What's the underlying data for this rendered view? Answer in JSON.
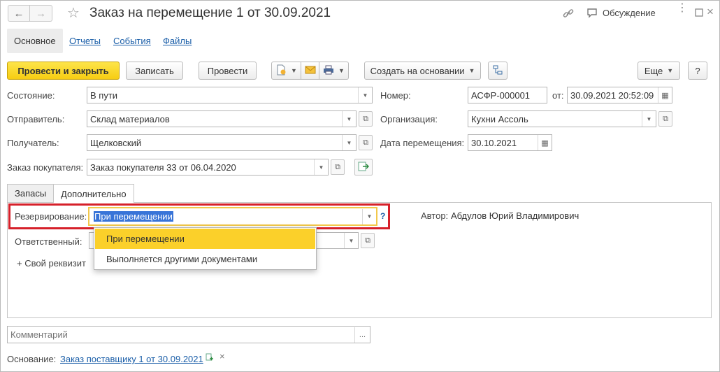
{
  "window": {
    "title": "Заказ на перемещение 1 от 30.09.2021",
    "discussion_label": "Обсуждение"
  },
  "top_tabs": [
    {
      "label": "Основное"
    },
    {
      "label": "Отчеты"
    },
    {
      "label": "События"
    },
    {
      "label": "Файлы"
    }
  ],
  "toolbar": {
    "post_close_label": "Провести и закрыть",
    "save_label": "Записать",
    "post_label": "Провести",
    "create_based_label": "Создать на основании",
    "more_label": "Еще",
    "help_label": "?"
  },
  "form": {
    "state_label": "Состояние:",
    "state_value": "В пути",
    "number_label": "Номер:",
    "number_value": "АСФР-000001",
    "from_label": "от:",
    "date_value": "30.09.2021 20:52:09",
    "sender_label": "Отправитель:",
    "sender_value": "Склад материалов",
    "org_label": "Организация:",
    "org_value": "Кухни Ассоль",
    "receiver_label": "Получатель:",
    "receiver_value": "Щелковский",
    "move_date_label": "Дата перемещения:",
    "move_date_value": "30.10.2021",
    "customer_order_label": "Заказ покупателя:",
    "customer_order_value": "Заказ покупателя 33 от 06.04.2020"
  },
  "inner_tabs": [
    {
      "label": "Запасы"
    },
    {
      "label": "Дополнительно"
    }
  ],
  "extra": {
    "reservation_label": "Резервирование:",
    "reservation_value": "При перемещении",
    "help_mark": "?",
    "author_label": "Автор:",
    "author_value": "Абдулов Юрий Владимирович",
    "responsible_label": "Ответственный:",
    "own_attr_label": "+ Свой реквизит"
  },
  "dropdown_options": [
    {
      "label": "При перемещении",
      "selected": true
    },
    {
      "label": "Выполняется другими документами",
      "selected": false
    }
  ],
  "comment": {
    "placeholder": "Комментарий",
    "button": "..."
  },
  "basis": {
    "label": "Основание:",
    "link": "Заказ поставщику 1 от 30.09.2021",
    "close": "×"
  },
  "colors": {
    "primary_yellow": "#f7cd12",
    "highlight_red": "#d6202a",
    "link_blue": "#1a5ea8",
    "selection_blue": "#3874d8"
  }
}
